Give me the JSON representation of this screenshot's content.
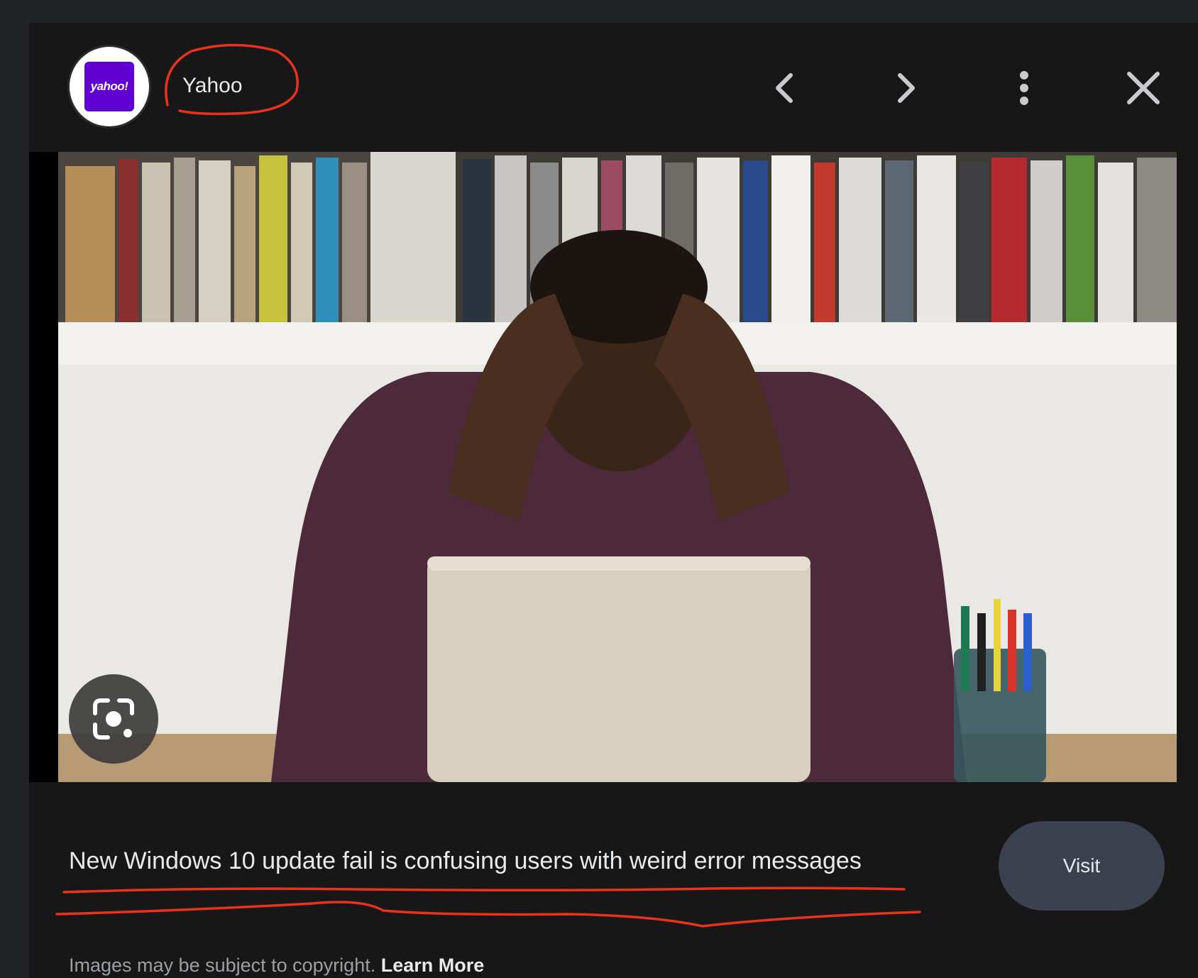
{
  "header": {
    "favicon_text": "yahoo!",
    "source_name": "Yahoo",
    "icons": {
      "previous": "chevron-left-icon",
      "next": "chevron-right-icon",
      "more": "more-vertical-icon",
      "close": "close-icon"
    }
  },
  "image": {
    "lens_icon": "google-lens-icon"
  },
  "footer": {
    "title": "New Windows 10 update fail is confusing users with weird error messages",
    "visit_label": "Visit",
    "copyright_text": "Images may be subject to copyright.",
    "learn_more": "Learn More"
  },
  "colors": {
    "background": "#202125",
    "panel": "#171717",
    "favicon_brand": "#6001d2",
    "visit_button": "#3c4150",
    "annotation": "#e8331c"
  }
}
